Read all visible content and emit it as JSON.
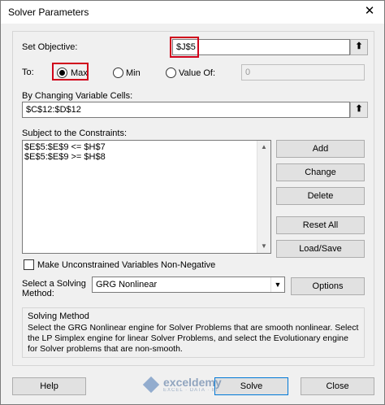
{
  "window": {
    "title": "Solver Parameters"
  },
  "objective": {
    "label": "Set Objective:",
    "value": "$J$5"
  },
  "to": {
    "label": "To:",
    "options": [
      {
        "label": "Max",
        "checked": true
      },
      {
        "label": "Min",
        "checked": false
      },
      {
        "label": "Value Of:",
        "checked": false
      }
    ],
    "value_of": "0"
  },
  "changing": {
    "label": "By Changing Variable Cells:",
    "value": "$C$12:$D$12"
  },
  "constraints": {
    "label": "Subject to the Constraints:",
    "items": [
      "$E$5:$E$9 <= $H$7",
      "$E$5:$E$9 >= $H$8"
    ]
  },
  "constraint_buttons": {
    "add": "Add",
    "change": "Change",
    "delete": "Delete",
    "reset": "Reset All",
    "load": "Load/Save"
  },
  "nonneg": {
    "label": "Make Unconstrained Variables Non-Negative",
    "checked": false
  },
  "method": {
    "label_line1": "Select a Solving",
    "label_line2": "Method:",
    "selected": "GRG Nonlinear",
    "options_button": "Options"
  },
  "solving_method": {
    "title": "Solving Method",
    "description": "Select the GRG Nonlinear engine for Solver Problems that are smooth nonlinear. Select the LP Simplex engine for linear Solver Problems, and select the Evolutionary engine for Solver problems that are non-smooth."
  },
  "footer": {
    "help": "Help",
    "solve": "Solve",
    "close": "Close"
  },
  "watermark": {
    "name": "exceldemy",
    "tagline": "EXCEL · DATA · BI"
  },
  "colors": {
    "highlight": "#d0021b",
    "accent": "#0078d7"
  }
}
